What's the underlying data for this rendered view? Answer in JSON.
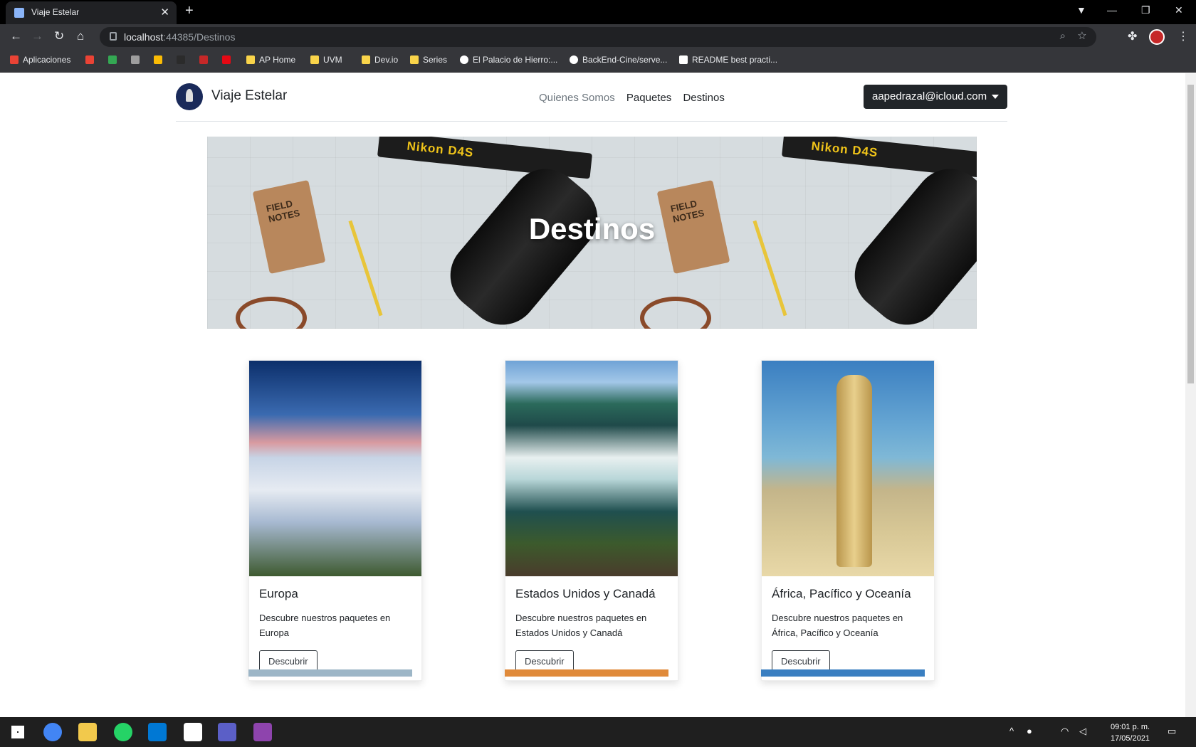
{
  "browser": {
    "tab_title": "Viaje Estelar",
    "url_host": "localhost",
    "url_path": ":44385/Destinos"
  },
  "bookmarks": [
    {
      "label": "Aplicaciones",
      "color": "#ea4335"
    },
    {
      "label": "AP Home",
      "color": "#f9d44a"
    },
    {
      "label": "UVM",
      "color": "#f9d44a"
    },
    {
      "label": "Dev.io",
      "color": "#f9d44a"
    },
    {
      "label": "Series",
      "color": "#f9d44a"
    },
    {
      "label": "El Palacio de Hierro:...",
      "color": "#ffffff"
    },
    {
      "label": "BackEnd-Cine/serve...",
      "color": "#ffffff"
    },
    {
      "label": "README best practi...",
      "color": "#ffffff"
    }
  ],
  "site": {
    "brand": "Viaje Estelar",
    "nav": [
      "Quienes Somos",
      "Paquetes",
      "Destinos"
    ],
    "user_email": "aapedrazal@icloud.com"
  },
  "hero": {
    "title": "Destinos",
    "notebook_text": "FIELD NOTES",
    "strap_text": "Nikon D4S"
  },
  "cards": [
    {
      "title": "Europa",
      "text": "Descubre nuestros paquetes en Europa",
      "button": "Descubrir"
    },
    {
      "title": "Estados Unidos y Canadá",
      "text": "Descubre nuestros paquetes en Estados Unidos y Canadá",
      "button": "Descubrir"
    },
    {
      "title": "África, Pacífico y Oceanía",
      "text": "Descubre nuestros paquetes en África, Pacífico y Oceanía",
      "button": "Descubrir"
    }
  ],
  "taskbar": {
    "time": "09:01 p. m.",
    "date": "17/05/2021"
  }
}
